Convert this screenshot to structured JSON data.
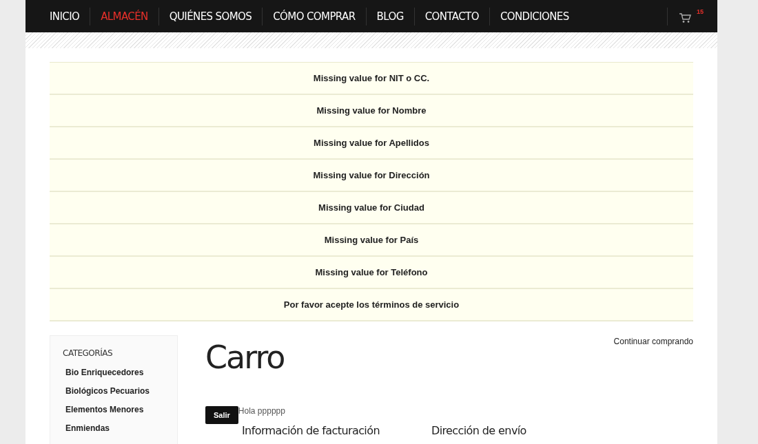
{
  "nav": {
    "items": [
      {
        "label": "INICIO",
        "selected": false
      },
      {
        "label": "ALMACÉN",
        "selected": true
      },
      {
        "label": "QUIÉNES SOMOS",
        "selected": false
      },
      {
        "label": "CÓMO COMPRAR",
        "selected": false
      },
      {
        "label": "BLOG",
        "selected": false
      },
      {
        "label": "CONTACTO",
        "selected": false
      },
      {
        "label": "CONDICIONES",
        "selected": false
      }
    ],
    "cart_count": "15"
  },
  "messages": [
    "Missing value for NIT o CC.",
    "Missing value for Nombre",
    "Missing value for Apellidos",
    "Missing value for Dirección",
    "Missing value for Ciudad",
    "Missing value for País",
    "Missing value for Teléfono",
    "Por favor acepte los términos de servicio"
  ],
  "sidebar": {
    "title": "CATEGORÍAS",
    "items": [
      "Bio Enriquecedores",
      "Biológicos Pecuarios",
      "Elementos Menores",
      "Enmiendas"
    ]
  },
  "content": {
    "title": "Carro",
    "continue_link": "Continuar comprando",
    "logout_button": "Salir",
    "greeting": "Hola pppppp",
    "billing_heading": "Información de facturación",
    "shipping_heading": "Dirección de envío"
  }
}
